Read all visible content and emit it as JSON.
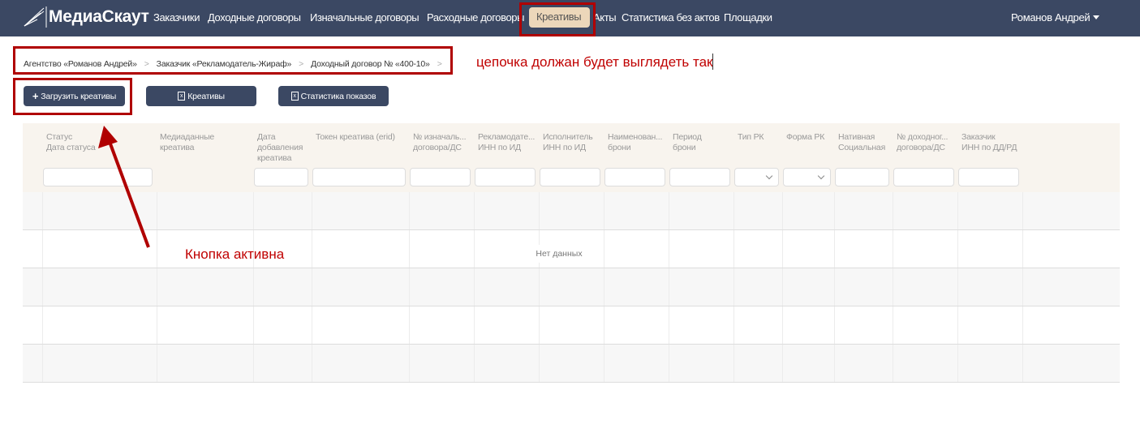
{
  "brand": "МедиаСкаут",
  "nav": [
    "Заказчики",
    "Доходные договоры",
    "Изначальные договоры",
    "Расходные договоры",
    "Креативы",
    "Акты",
    "Статистика без актов",
    "Площадки"
  ],
  "user": "Романов Андрей",
  "breadcrumbs": [
    "Агентство «Романов Андрей»",
    "Заказчик «Рекламодатель-Жираф»",
    "Доходный договор № «400-10»"
  ],
  "annotations": {
    "chain": "цепочка должан будет выглядеть так",
    "button": "Кнопка активна"
  },
  "buttons": {
    "upload": "Загрузить креативы",
    "creatives": "Креативы",
    "stats": "Статистика показов"
  },
  "columns": [
    "Статус\nДата статуса",
    "Медиаданные\nкреатива",
    "Дата\nдобавления\nкреатива",
    "Токен креатива (erid)",
    "№ изначаль...\nдоговора/ДС",
    "Рекламодате...\nИНН по ИД",
    "Исполнитель\nИНН по ИД",
    "Наименован...\nброни",
    "Период\nброни",
    "Тип РК",
    "Форма РК",
    "Нативная\nСоциальная",
    "№ доходног...\nдоговора/ДС",
    "Заказчик\nИНН по ДД/РД"
  ],
  "empty": "Нет данных",
  "colors": {
    "nav": "#3b4863",
    "active": "#ecd7ba",
    "annotation": "#c00000"
  }
}
